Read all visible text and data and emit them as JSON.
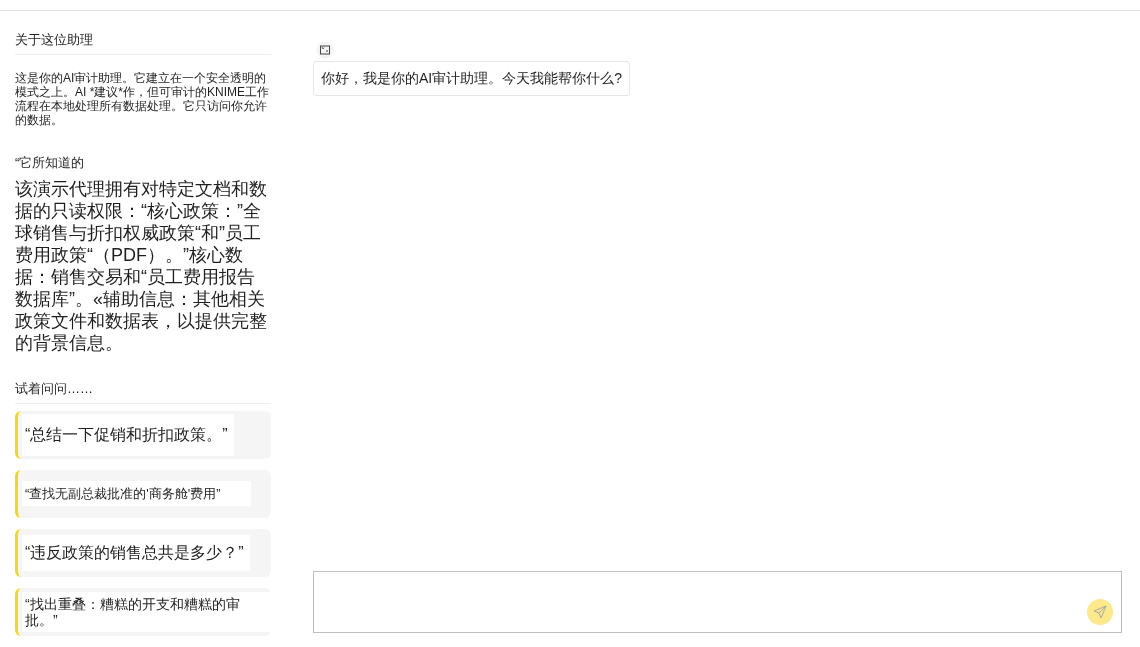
{
  "sidebar": {
    "about": {
      "title": "关于这位助理",
      "text": "这是你的AI审计助理。它建立在一个安全透明的模式之上。AI *建议*作，但可审计的KNIME工作流程在本地处理所有数据处理。它只访问你允许的数据。"
    },
    "knowledge": {
      "title": "“它所知道的",
      "text": "该演示代理拥有对特定文档和数据的只读权限：“核心政策：”全球销售与折扣权威政策“和”员工费用政策“（PDF）。”核心数据：销售交易和“员工费用报告数据库”。«辅助信息：其他相关政策文件和数据表，以提供完整的背景信息。"
    },
    "prompts": {
      "title": "试着问问……",
      "items": [
        {
          "text": "“总结一下促销和折扣政策。”"
        },
        {
          "text": "“查找无副总裁批准的'商务舱'费用”"
        },
        {
          "text": "“违反政策的销售总共是多少？”"
        },
        {
          "text": "“找出重叠：糟糕的开支和糟糕的审批。”"
        }
      ]
    }
  },
  "chat": {
    "messages": [
      {
        "text": "你好，我是你的AI审计助理。今天我能帮你什么?"
      }
    ],
    "composer": {
      "send_enabled": false
    }
  }
}
